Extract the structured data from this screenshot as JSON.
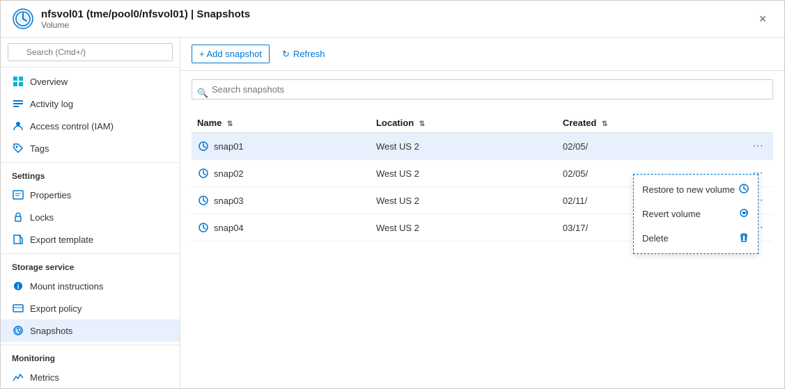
{
  "window": {
    "title": "nfsvol01 (tme/pool0/nfsvol01) | Snapshots",
    "subtitle": "Volume",
    "close_label": "×"
  },
  "sidebar": {
    "search_placeholder": "Search (Cmd+/)",
    "items": [
      {
        "id": "overview",
        "label": "Overview",
        "icon": "overview-icon"
      },
      {
        "id": "activity-log",
        "label": "Activity log",
        "icon": "activity-icon"
      },
      {
        "id": "access-control",
        "label": "Access control (IAM)",
        "icon": "iam-icon"
      },
      {
        "id": "tags",
        "label": "Tags",
        "icon": "tags-icon"
      }
    ],
    "sections": [
      {
        "header": "Settings",
        "items": [
          {
            "id": "properties",
            "label": "Properties",
            "icon": "properties-icon"
          },
          {
            "id": "locks",
            "label": "Locks",
            "icon": "locks-icon"
          },
          {
            "id": "export-template",
            "label": "Export template",
            "icon": "export-template-icon"
          }
        ]
      },
      {
        "header": "Storage service",
        "items": [
          {
            "id": "mount-instructions",
            "label": "Mount instructions",
            "icon": "mount-icon"
          },
          {
            "id": "export-policy",
            "label": "Export policy",
            "icon": "export-policy-icon"
          },
          {
            "id": "snapshots",
            "label": "Snapshots",
            "icon": "snapshots-icon",
            "active": true
          }
        ]
      },
      {
        "header": "Monitoring",
        "items": [
          {
            "id": "metrics",
            "label": "Metrics",
            "icon": "metrics-icon"
          }
        ]
      }
    ]
  },
  "toolbar": {
    "add_snapshot_label": "+ Add snapshot",
    "refresh_label": "Refresh"
  },
  "search": {
    "placeholder": "Search snapshots"
  },
  "table": {
    "columns": [
      {
        "id": "name",
        "label": "Name"
      },
      {
        "id": "location",
        "label": "Location"
      },
      {
        "id": "created",
        "label": "Created"
      }
    ],
    "rows": [
      {
        "id": "snap01",
        "name": "snap01",
        "location": "West US 2",
        "created": "02/05/",
        "selected": true
      },
      {
        "id": "snap02",
        "name": "snap02",
        "location": "West US 2",
        "created": "02/05/",
        "selected": false
      },
      {
        "id": "snap03",
        "name": "snap03",
        "location": "West US 2",
        "created": "02/11/",
        "selected": false
      },
      {
        "id": "snap04",
        "name": "snap04",
        "location": "West US 2",
        "created": "03/17/",
        "selected": false
      }
    ]
  },
  "context_menu": {
    "items": [
      {
        "id": "restore-new-volume",
        "label": "Restore to new volume",
        "icon": "restore-icon"
      },
      {
        "id": "revert-volume",
        "label": "Revert volume",
        "icon": "revert-icon"
      },
      {
        "id": "delete",
        "label": "Delete",
        "icon": "delete-icon"
      }
    ]
  }
}
